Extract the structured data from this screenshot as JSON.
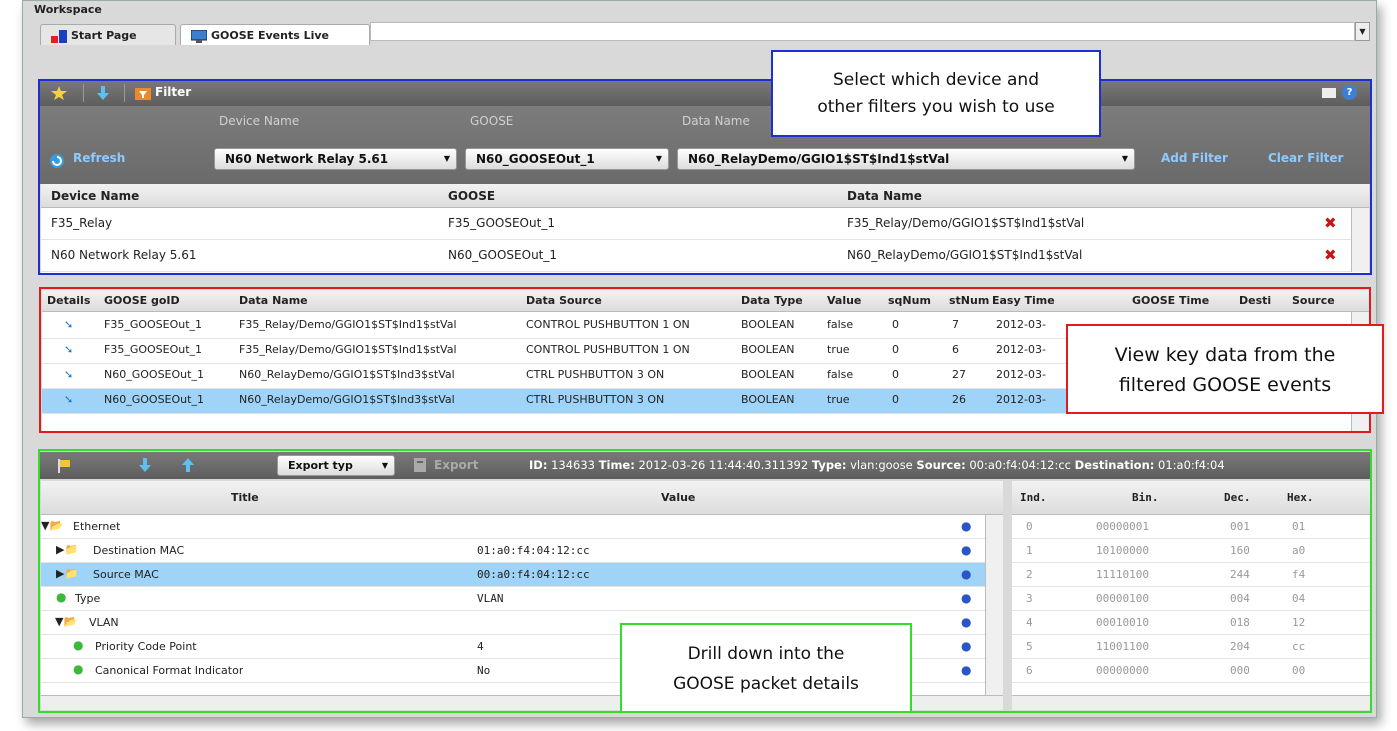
{
  "workspace": {
    "title": "Workspace"
  },
  "tabs": [
    {
      "label": "Start Page"
    },
    {
      "label": "GOOSE Events Live"
    }
  ],
  "filter": {
    "toolbar_label": "Filter",
    "refresh_label": "Refresh",
    "labels": {
      "device": "Device Name",
      "goose": "GOOSE",
      "data": "Data Name"
    },
    "device_value": "N60 Network Relay  5.61",
    "goose_value": "N60_GOOSEOut_1",
    "data_value": "N60_RelayDemo/GGIO1$ST$Ind1$stVal",
    "add_filter": "Add Filter",
    "clear_filter": "Clear Filter",
    "table_headers": [
      "Device Name",
      "GOOSE",
      "Data Name"
    ],
    "rows": [
      {
        "device": "F35_Relay",
        "goose": "F35_GOOSEOut_1",
        "data": "F35_Relay/Demo/GGIO1$ST$Ind1$stVal"
      },
      {
        "device": "N60 Network Relay  5.61",
        "goose": "N60_GOOSEOut_1",
        "data": "N60_RelayDemo/GGIO1$ST$Ind1$stVal"
      }
    ]
  },
  "events": {
    "headers": [
      "Details",
      "GOOSE goID",
      "Data Name",
      "Data Source",
      "Data Type",
      "Value",
      "sqNum",
      "stNum",
      "Easy Time",
      "GOOSE Time",
      "Desti",
      "Source"
    ],
    "rows": [
      {
        "goid": "F35_GOOSEOut_1",
        "data": "F35_Relay/Demo/GGIO1$ST$Ind1$stVal",
        "source": "CONTROL PUSHBUTTON 1 ON",
        "type": "BOOLEAN",
        "value": "false",
        "sq": "0",
        "st": "7",
        "time": "2012-03-"
      },
      {
        "goid": "F35_GOOSEOut_1",
        "data": "F35_Relay/Demo/GGIO1$ST$Ind1$stVal",
        "source": "CONTROL PUSHBUTTON 1 ON",
        "type": "BOOLEAN",
        "value": "true",
        "sq": "0",
        "st": "6",
        "time": "2012-03-"
      },
      {
        "goid": "N60_GOOSEOut_1",
        "data": "N60_RelayDemo/GGIO1$ST$Ind3$stVal",
        "source": "CTRL PUSHBUTTON 3 ON",
        "type": "BOOLEAN",
        "value": "false",
        "sq": "0",
        "st": "27",
        "time": "2012-03-"
      },
      {
        "goid": "N60_GOOSEOut_1",
        "data": "N60_RelayDemo/GGIO1$ST$Ind3$stVal",
        "source": "CTRL PUSHBUTTON 3 ON",
        "type": "BOOLEAN",
        "value": "true",
        "sq": "0",
        "st": "26",
        "time": "2012-03-"
      }
    ]
  },
  "packet": {
    "export_type": "Export typ",
    "export": "Export",
    "info": {
      "id_label": "ID:",
      "id": "134633",
      "time_label": "Time:",
      "time": "2012-03-26 11:44:40.311392",
      "type_label": "Type:",
      "type": "vlan:goose",
      "source_label": "Source:",
      "source": "00:a0:f4:04:12:cc",
      "dest_label": "Destination:",
      "dest": "01:a0:f4:04"
    },
    "tree_headers": [
      "Title",
      "Value"
    ],
    "tree": [
      {
        "title": "Ethernet",
        "value": ""
      },
      {
        "title": "Destination MAC",
        "value": "01:a0:f4:04:12:cc"
      },
      {
        "title": "Source MAC",
        "value": "00:a0:f4:04:12:cc"
      },
      {
        "title": "Type",
        "value": "VLAN"
      },
      {
        "title": "VLAN",
        "value": ""
      },
      {
        "title": "Priority Code Point",
        "value": "4"
      },
      {
        "title": "Canonical Format Indicator",
        "value": "No"
      }
    ],
    "bin_headers": [
      "Ind.",
      "Bin.",
      "Dec.",
      "Hex."
    ],
    "bytes": [
      {
        "ind": "0",
        "bin": "00000001",
        "dec": "001",
        "hex": "01"
      },
      {
        "ind": "1",
        "bin": "10100000",
        "dec": "160",
        "hex": "a0"
      },
      {
        "ind": "2",
        "bin": "11110100",
        "dec": "244",
        "hex": "f4"
      },
      {
        "ind": "3",
        "bin": "00000100",
        "dec": "004",
        "hex": "04"
      },
      {
        "ind": "4",
        "bin": "00010010",
        "dec": "018",
        "hex": "12"
      },
      {
        "ind": "5",
        "bin": "11001100",
        "dec": "204",
        "hex": "cc"
      },
      {
        "ind": "6",
        "bin": "00000000",
        "dec": "000",
        "hex": "00"
      }
    ]
  },
  "annotations": {
    "filter_line1": "Select which device and",
    "filter_line2": "other filters you wish to use",
    "events_line1": "View key data from the",
    "events_line2": "filtered GOOSE events",
    "packet_line1": "Drill down into the",
    "packet_line2": "GOOSE packet details"
  },
  "colors": {
    "blue_box": "#1c2fd1",
    "red_box": "#e11b1b",
    "green_box": "#33dd2a",
    "selected_row": "#9fd3f7"
  }
}
